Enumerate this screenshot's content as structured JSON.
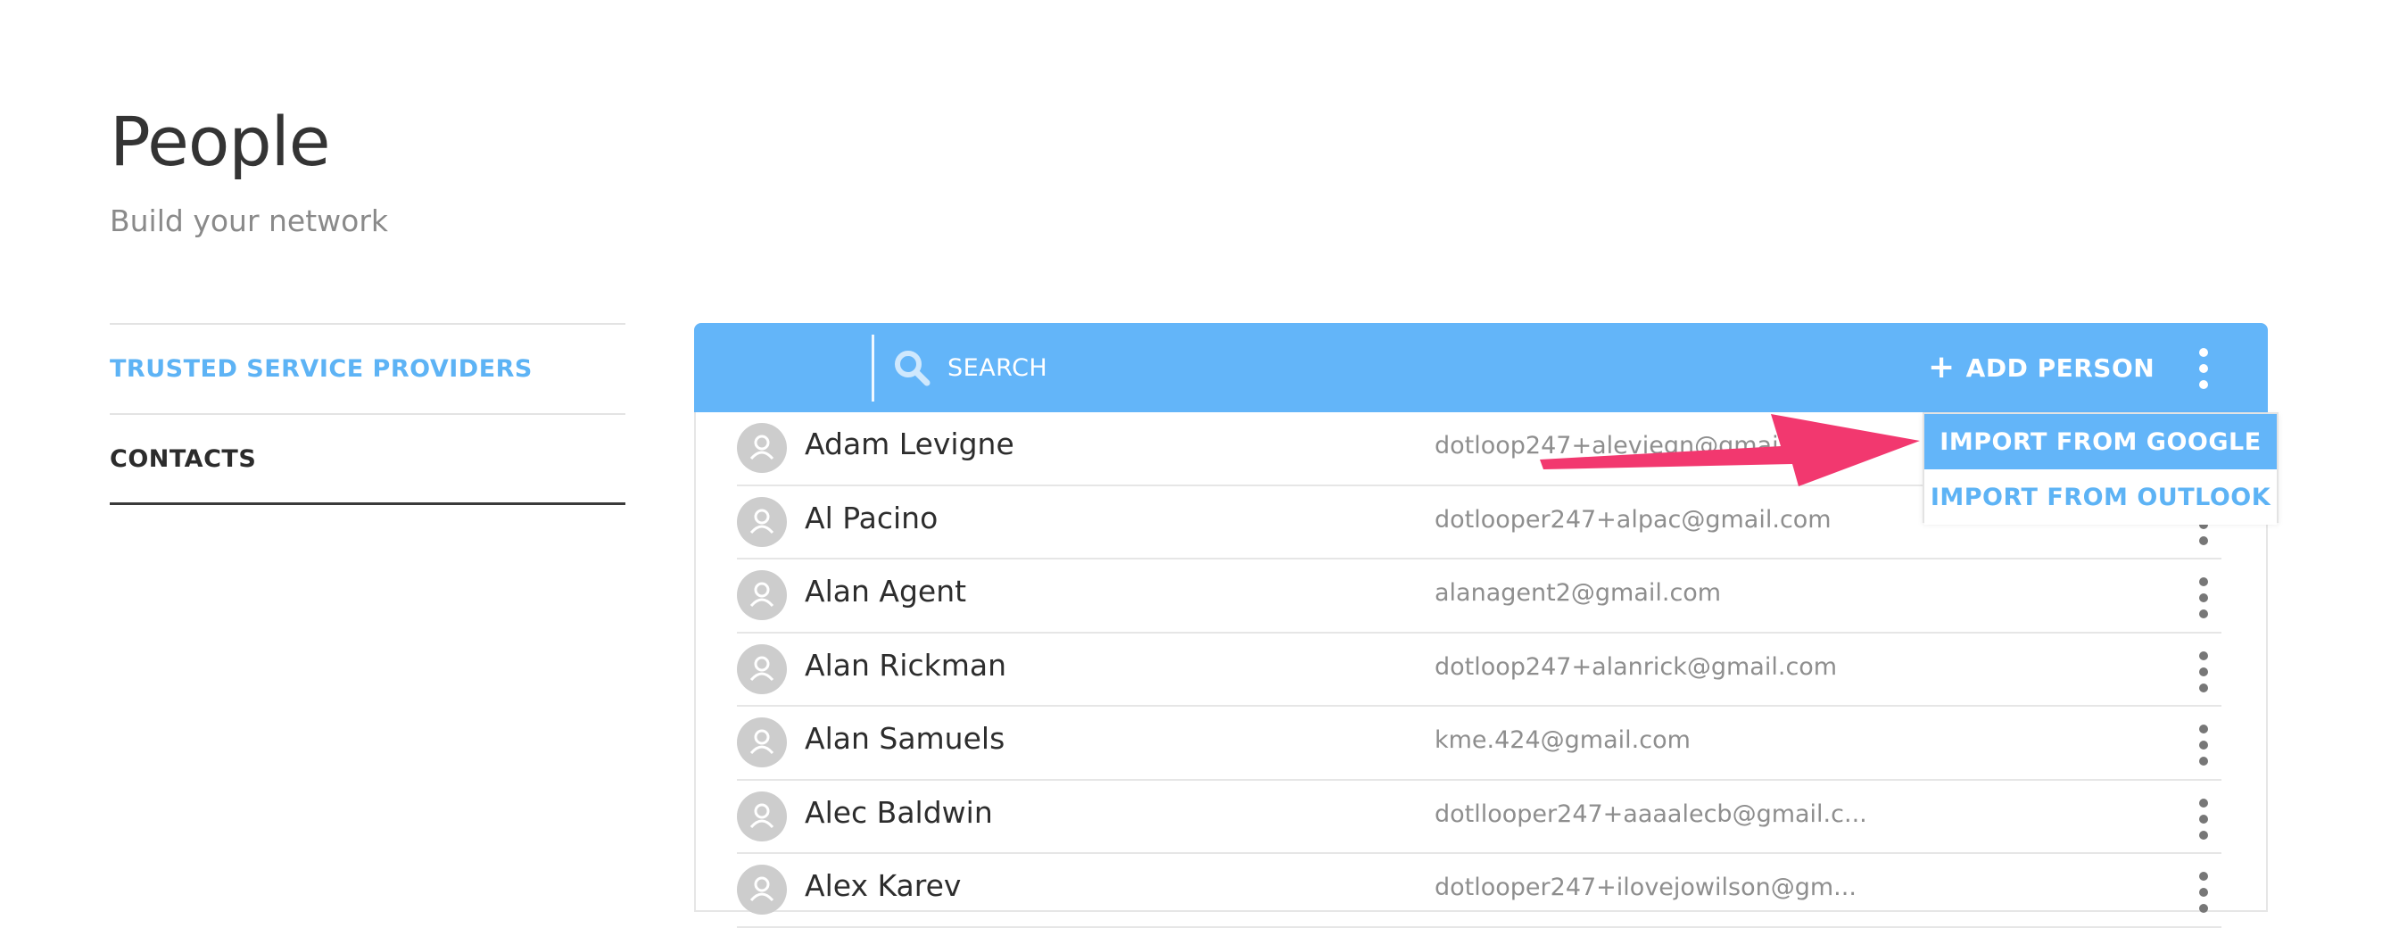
{
  "page": {
    "title": "People",
    "subtitle": "Build your network"
  },
  "sidebar": {
    "items": [
      {
        "label": "TRUSTED SERVICE PROVIDERS"
      },
      {
        "label": "CONTACTS"
      }
    ]
  },
  "toolbar": {
    "search_placeholder": "SEARCH",
    "add_person_label": "ADD PERSON",
    "add_person_icon": "plus-icon",
    "menu_icon": "kebab-menu-icon"
  },
  "dropdown": {
    "items": [
      {
        "label": "IMPORT FROM GOOGLE"
      },
      {
        "label": "IMPORT FROM OUTLOOK"
      }
    ]
  },
  "contacts": [
    {
      "name": "Adam Levigne",
      "email": "dotloop247+aleviegn@gmail.com"
    },
    {
      "name": "Al Pacino",
      "email": "dotlooper247+alpac@gmail.com"
    },
    {
      "name": "Alan Agent",
      "email": "alanagent2@gmail.com"
    },
    {
      "name": "Alan Rickman",
      "email": "dotloop247+alanrick@gmail.com"
    },
    {
      "name": "Alan Samuels",
      "email": "kme.424@gmail.com"
    },
    {
      "name": "Alec Baldwin",
      "email": "dotllooper247+aaaalecb@gmail.c..."
    },
    {
      "name": "Alex Karev",
      "email": "dotlooper247+ilovejowilson@gm..."
    }
  ],
  "colors": {
    "accent": "#63b5f9",
    "link": "#5db3f5",
    "annotation_arrow": "#f2386f"
  }
}
